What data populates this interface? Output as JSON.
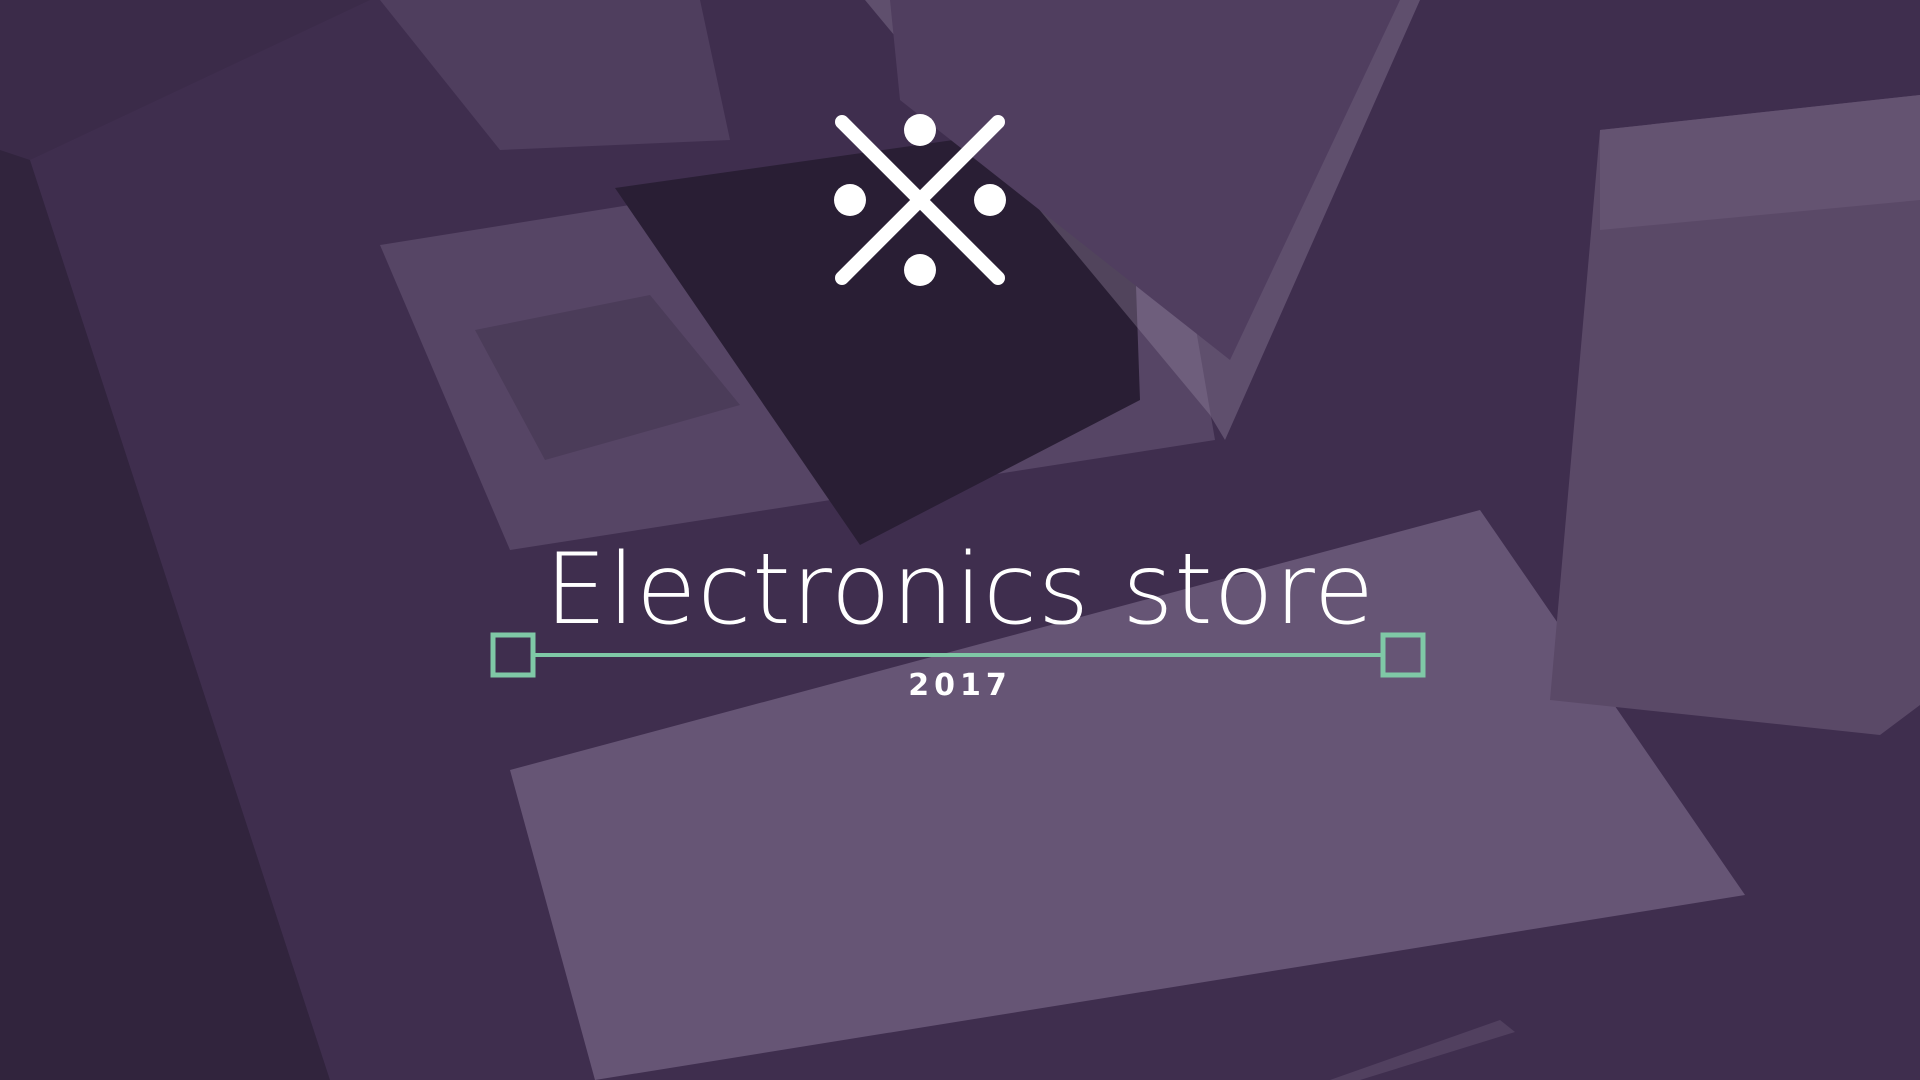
{
  "slide": {
    "title": "Electronics store",
    "year": "2017"
  },
  "logo": {
    "icon": "x-with-dots-logo-icon",
    "color": "#ffffff"
  },
  "divider": {
    "color": "#7fc8a6"
  },
  "overlay_color": "#4a3a5c"
}
